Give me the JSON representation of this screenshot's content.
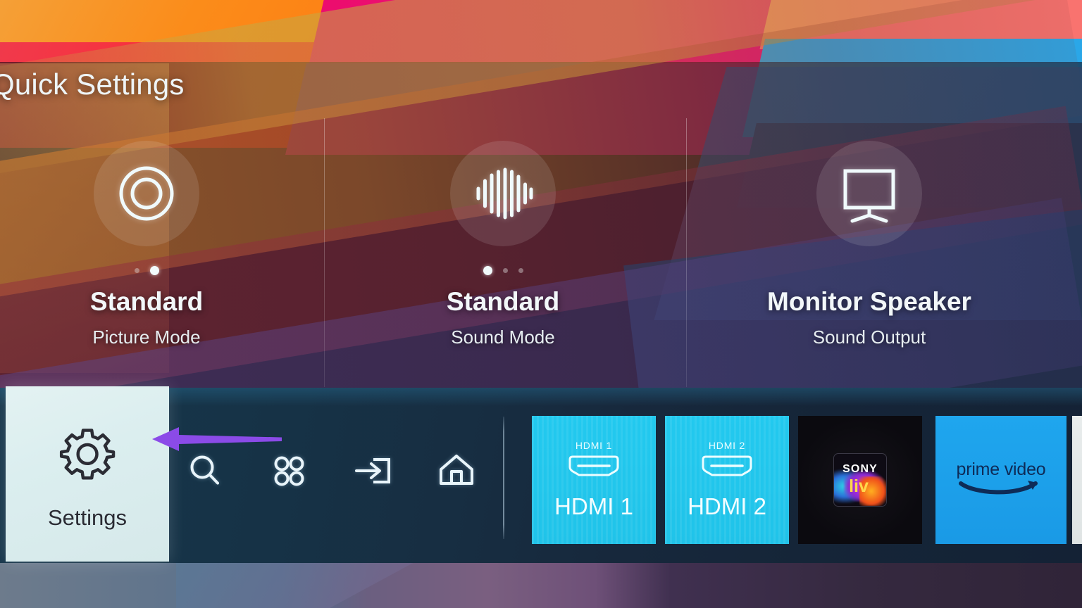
{
  "panel": {
    "title": "Quick Settings"
  },
  "quick_settings": {
    "items": [
      {
        "icon": "picture-mode-icon",
        "value": "Standard",
        "label": "Picture Mode",
        "dots": {
          "count": 2,
          "active_index": 1
        }
      },
      {
        "icon": "sound-mode-icon",
        "value": "Standard",
        "label": "Sound Mode",
        "dots": {
          "count": 3,
          "active_index": 0
        }
      },
      {
        "icon": "sound-output-icon",
        "value": "Monitor Speaker",
        "label": "Sound Output",
        "dots": {
          "count": 0,
          "active_index": -1
        }
      }
    ]
  },
  "dock": {
    "settings": {
      "icon": "gear-icon",
      "label": "Settings",
      "selected": true
    },
    "nav_icons": [
      {
        "name": "search-icon",
        "label": "Search"
      },
      {
        "name": "apps-icon",
        "label": "Apps"
      },
      {
        "name": "source-input-icon",
        "label": "Source"
      },
      {
        "name": "home-icon",
        "label": "Home"
      }
    ],
    "tiles": [
      {
        "name": "hdmi-1-tile",
        "type": "hdmi",
        "port_label": "HDMI 1",
        "title": "HDMI 1",
        "color": "#20c3e9"
      },
      {
        "name": "hdmi-2-tile",
        "type": "hdmi",
        "port_label": "HDMI 2",
        "title": "HDMI 2",
        "color": "#20c3e9"
      },
      {
        "name": "sony-liv-tile",
        "type": "app",
        "brand_top": "SONY",
        "brand_bottom": "liv",
        "color": "#0b0a0f"
      },
      {
        "name": "prime-video-tile",
        "type": "app",
        "brand": "prime video",
        "color": "#1fa6ee"
      }
    ]
  },
  "annotation": {
    "arrow": {
      "name": "callout-arrow",
      "direction": "left",
      "color": "#8b4be8",
      "points_to": "Settings"
    }
  },
  "colors": {
    "dock_background": "#163347",
    "settings_tile": "#dbeeef",
    "hdmi_tile": "#20c3e9",
    "prime_tile": "#1fa6ee",
    "accent_arrow": "#8b4be8",
    "text_primary": "#f2f7f9"
  }
}
